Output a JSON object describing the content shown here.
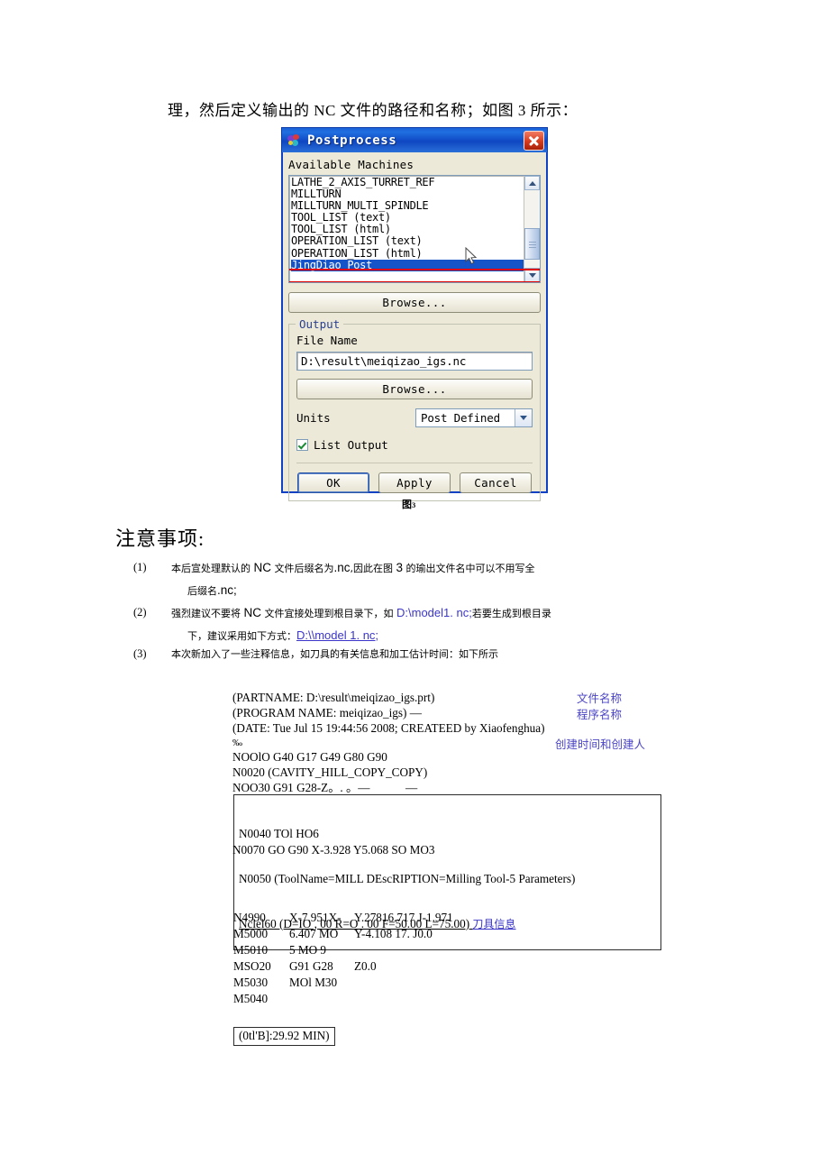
{
  "intro": {
    "text": "理，然后定义输出的 NC 文件的路径和名称；如图 3 所示："
  },
  "dialog": {
    "title": "Postprocess",
    "close_label": "×",
    "available_machines_label": "Available Machines",
    "machines": [
      "LATHE_2_AXIS_TURRET_REF",
      "MILLTURN",
      "MILLTURN_MULTI_SPINDLE",
      "TOOL_LIST (text)",
      "TOOL_LIST (html)",
      "OPERATION_LIST (text)",
      "OPERATION_LIST (html)",
      "JingDiao Post"
    ],
    "selected_machine": "JingDiao Post",
    "browse_top_label": "Browse...",
    "output_group_label": "Output",
    "file_name_label": "File Name",
    "file_name_value": "D:\\result\\meiqizao_igs.nc",
    "browse_bottom_label": "Browse...",
    "units_label": "Units",
    "units_value": "Post Defined",
    "list_output_label": "List Output",
    "list_output_checked": true,
    "ok_label": "OK",
    "apply_label": "Apply",
    "cancel_label": "Cancel",
    "highlight_color": "#e00000",
    "titlebar_color": "#0f47c2",
    "selection_color": "#1453c8"
  },
  "figure_caption": {
    "label": "图",
    "number": "3"
  },
  "notes": {
    "heading": "注意事项:",
    "items": [
      {
        "marker": "(1)",
        "line1_a": "本后宣处理默认的 ",
        "line1_big1": "NC",
        "line1_b": " 文件后缀名为",
        "line1_big2": ".nc",
        "line1_c": ",因此在图 ",
        "line1_big3": "3",
        "line1_d": " 的瑜出文件名中可以不用写全",
        "line2_a": "后缀名",
        "line2_big": ".nc;"
      },
      {
        "marker": "(2)",
        "line1_a": "强烈建议不要将 ",
        "line1_big": "NC",
        "line1_b": " 文件宜接处理到根目录下，如 ",
        "line1_link": "D:\\model1. nc;",
        "line1_c": "若要生成到根目录",
        "line2_a": "下，建议采用如下方式：",
        "line2_link": "D:\\\\model 1. nc;"
      },
      {
        "marker": "(3)",
        "line1_a": "本次新加入了一些注释信息，如刀具的有关信息和加工估计时间：如下所示"
      }
    ]
  },
  "nc_code": {
    "header_lines": [
      "(PARTNAME: D:\\result\\meiqizao_igs.prt)",
      "(PROGRAM NAME: meiqizao_igs) —",
      "(DATE: Tue Jul 15 19:44:56 2008; CREATEED by Xiaofenghua)"
    ],
    "percent": "‰",
    "body_lines": [
      "NOOlO G40 G17 G49 G80 G90",
      "N0020 (CAVITY_HILL_COPY_COPY)",
      "NOO30 G91 G28-Z。. 。—            —"
    ],
    "boxed_lines": [
      "N0040 TOl HO6",
      "N0050 (ToolName=MILL DEscRIPTION=Milling Tool-5 Parameters)"
    ],
    "boxed_underlined": "Nclel60 (D=IO , 00 R=O . 00 F=50.00 L=75.00)",
    "boxed_annotation": "刀具信息",
    "after_box_line": "N0070 GO G90 X-3.928 Y5.068 SO MO3",
    "annotations": [
      {
        "text": "文件名称"
      },
      {
        "text": "程序名称"
      },
      {
        "text": "创建时间和创建人"
      }
    ],
    "tail_rows": [
      {
        "c1": "N4990",
        "c2": "X-7.951X-",
        "c3": "Y.27816.717 J-1.971"
      },
      {
        "c1": "M5000",
        "c2": "6.407 MO",
        "c3": "Y-4.108 17. J0.0"
      },
      {
        "c1": "M5010",
        "c2": "5 MO 9",
        "c3": ""
      },
      {
        "c1": "MSO20",
        "c2": "G91 G28",
        "c3": "Z0.0"
      },
      {
        "c1": "M5030",
        "c2": "MOl M30",
        "c3": ""
      },
      {
        "c1": "M5040",
        "c2": "",
        "c3": ""
      }
    ],
    "time_box": "(0tl'B]:29.92 MIN)"
  }
}
